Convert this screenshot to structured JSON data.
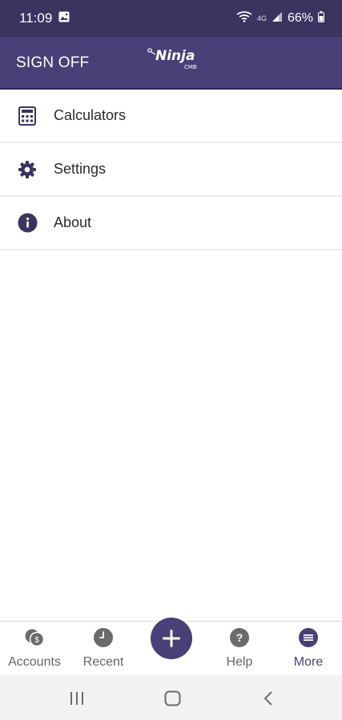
{
  "status_bar": {
    "time": "11:09",
    "network": "4G",
    "battery": "66%"
  },
  "app_bar": {
    "sign_off": "SIGN OFF",
    "logo_text": "Ninja",
    "logo_sub": "CMB"
  },
  "menu": {
    "items": [
      {
        "label": "Calculators",
        "icon": "calculator-icon"
      },
      {
        "label": "Settings",
        "icon": "gear-icon"
      },
      {
        "label": "About",
        "icon": "info-icon"
      }
    ]
  },
  "bottom_nav": {
    "items": [
      {
        "label": "Accounts",
        "icon": "accounts-icon"
      },
      {
        "label": "Recent",
        "icon": "clock-icon"
      },
      {
        "label": "Help",
        "icon": "help-icon"
      },
      {
        "label": "More",
        "icon": "more-icon",
        "active": true
      }
    ],
    "fab_icon": "plus-icon"
  },
  "colors": {
    "status_bar": "#3c3360",
    "app_bar": "#4b3f77",
    "accent": "#4b3f77",
    "nav_icon": "#6b6b6b"
  }
}
